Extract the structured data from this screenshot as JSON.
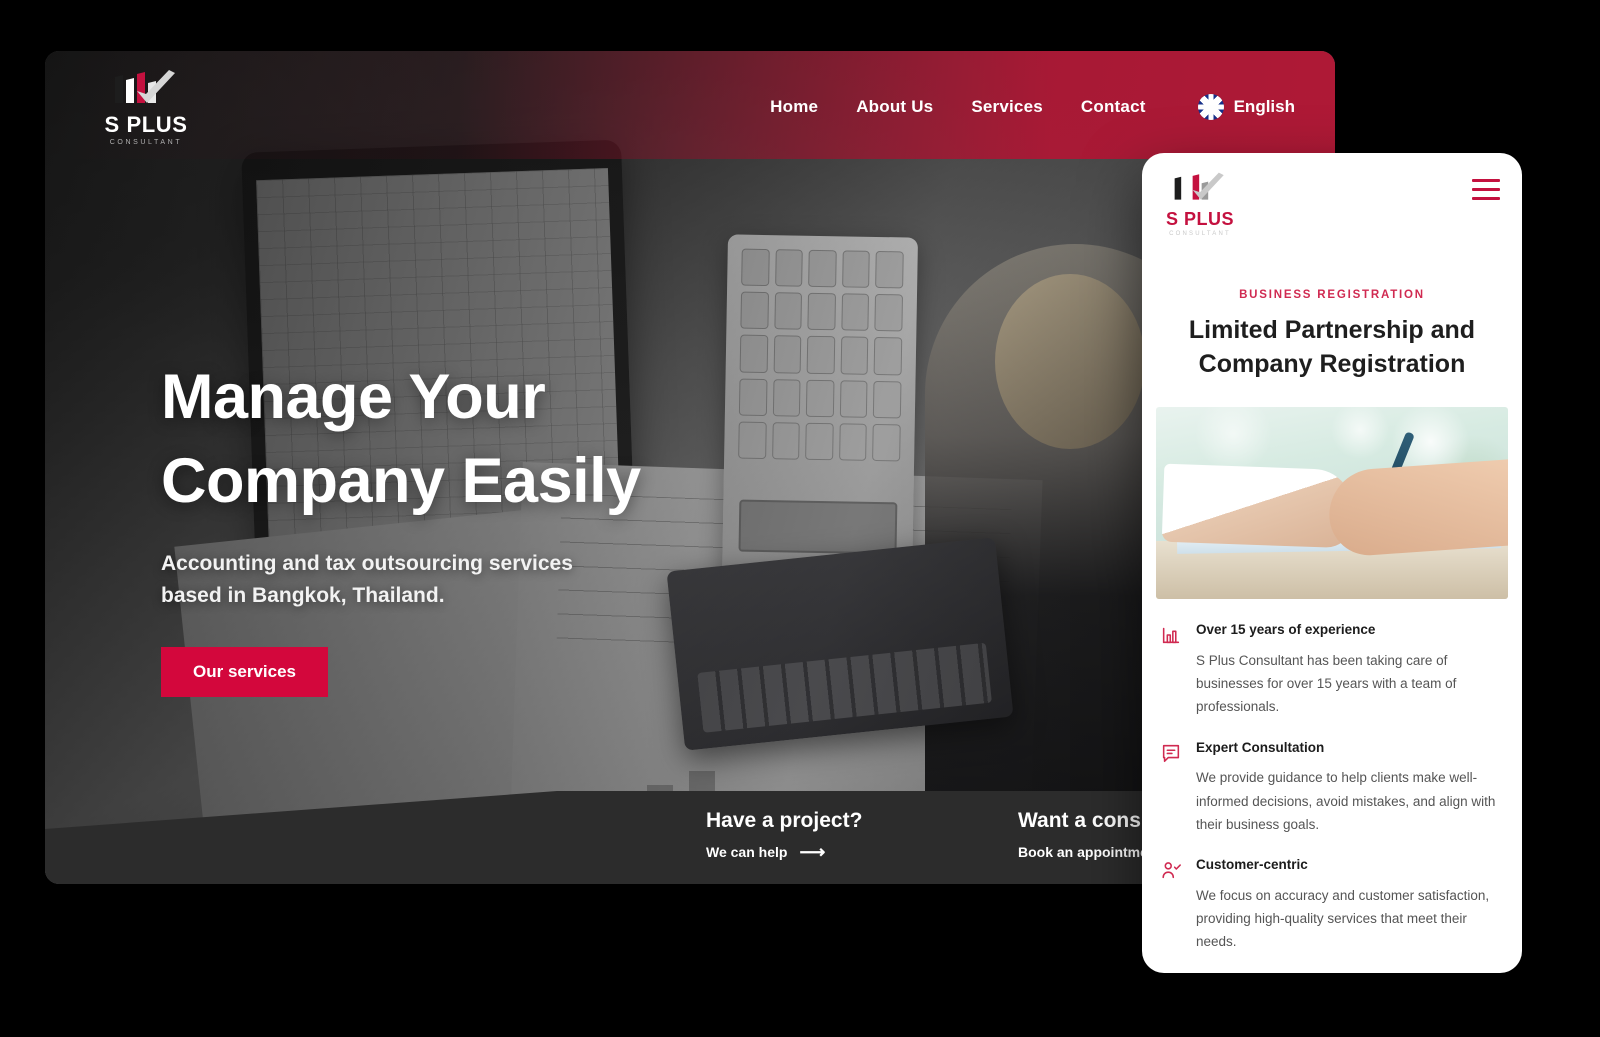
{
  "brand": {
    "name": "S PLUS",
    "tagline": "CONSULTANT",
    "logo_icon": "s-plus-logo-icon",
    "accent_color": "#d3073c",
    "crimson": "#c4113f"
  },
  "desktop": {
    "nav": {
      "items": [
        {
          "label": "Home"
        },
        {
          "label": "About Us"
        },
        {
          "label": "Services"
        },
        {
          "label": "Contact"
        }
      ],
      "language": {
        "label": "English",
        "flag_icon": "uk-flag-icon"
      }
    },
    "hero": {
      "title_line1": "Manage Your",
      "title_line2": "Company Easily",
      "subtitle_line1": "Accounting and tax outsourcing services",
      "subtitle_line2": "based in Bangkok, Thailand.",
      "cta_label": "Our services"
    },
    "cta_bar": {
      "items": [
        {
          "title": "Have a project?",
          "link_label": "We can help",
          "arrow_icon": "arrow-right-icon"
        },
        {
          "title": "Want a consultation?",
          "link_label": "Book an appointment",
          "arrow_icon": "arrow-right-icon"
        }
      ]
    }
  },
  "mobile": {
    "menu_icon": "hamburger-menu-icon",
    "eyebrow": "BUSINESS REGISTRATION",
    "title_line1": "Limited Partnership and",
    "title_line2": "Company Registration",
    "photo_alt": "signing-document-photo",
    "features": [
      {
        "icon": "bar-chart-icon",
        "title": "Over 15 years of experience",
        "text": "S Plus Consultant has been taking care of businesses for over 15 years with a team of professionals."
      },
      {
        "icon": "chat-bubble-icon",
        "title": "Expert Consultation",
        "text": "We provide guidance to help clients make well-informed decisions, avoid mistakes, and align with their business goals."
      },
      {
        "icon": "user-check-icon",
        "title": "Customer-centric",
        "text": "We focus on accuracy and customer satisfaction, providing high-quality services that meet their needs."
      }
    ]
  }
}
